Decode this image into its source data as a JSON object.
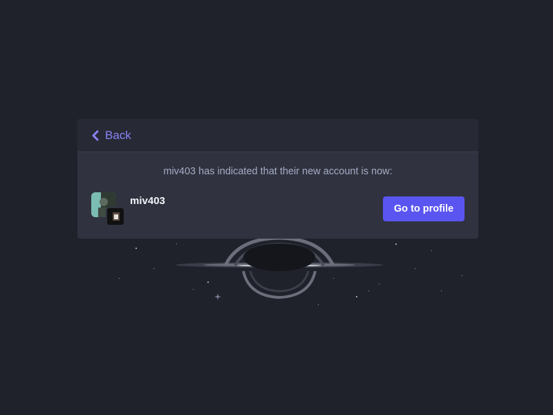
{
  "header": {
    "back_label": "Back"
  },
  "notice": {
    "message": "miv403 has indicated that their new account is now:"
  },
  "account": {
    "username": "miv403",
    "button_label": "Go to profile"
  },
  "colors": {
    "page_bg": "#1f222b",
    "card_bg": "#30323f",
    "header_bg": "#272935",
    "accent": "#5a55f0",
    "back_link": "#8b84f5",
    "message_text": "#a5acc4"
  },
  "icons": {
    "back": "chevron-left-icon"
  }
}
